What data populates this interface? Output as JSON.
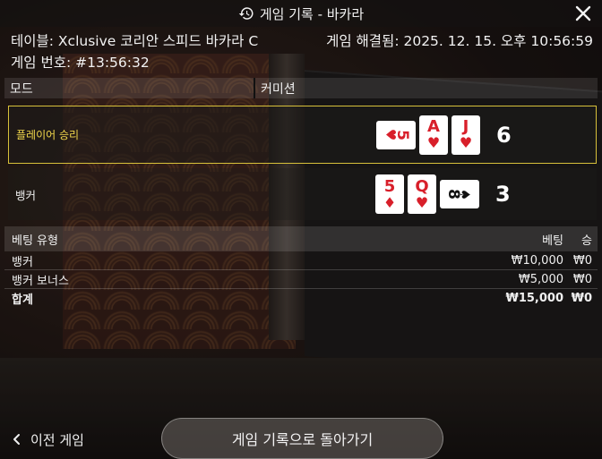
{
  "header": {
    "title": "게임 기록 - 바카라"
  },
  "info": {
    "table": "테이블: Xclusive 코리안 스피드 바카라 C",
    "resolved": "게임 해결됨: 2025. 12. 15. 오후 10:56:59",
    "game_number": "게임 번호: #13:56:32"
  },
  "mode_bar": {
    "mode_label": "모드",
    "commission_label": "커미션"
  },
  "results": {
    "player": {
      "label": "플레이어 승리",
      "score": "6",
      "cards": [
        {
          "rank": "5",
          "suit": "♥",
          "orientation": "sideways",
          "color": "red"
        },
        {
          "rank": "A",
          "suit": "♥",
          "orientation": "upright",
          "color": "red"
        },
        {
          "rank": "J",
          "suit": "♥",
          "orientation": "upright",
          "color": "red"
        }
      ]
    },
    "banker": {
      "label": "뱅커",
      "score": "3",
      "cards": [
        {
          "rank": "5",
          "suit": "♦",
          "orientation": "upright",
          "color": "red"
        },
        {
          "rank": "Q",
          "suit": "♥",
          "orientation": "upright",
          "color": "red"
        },
        {
          "rank": "8",
          "suit": "♠",
          "orientation": "sideways",
          "color": "black"
        }
      ]
    }
  },
  "bets": {
    "headers": {
      "type": "베팅 유형",
      "bet": "베팅",
      "win": "승"
    },
    "rows": [
      {
        "type": "뱅커",
        "bet": "₩10,000",
        "win": "₩0"
      },
      {
        "type": "뱅커 보너스",
        "bet": "₩5,000",
        "win": "₩0"
      }
    ],
    "total": {
      "type": "합계",
      "bet": "₩15,000",
      "win": "₩0"
    }
  },
  "footer": {
    "prev_game": "이전 게임",
    "back_button": "게임 기록으로 돌아가기"
  },
  "colors": {
    "player_highlight": "#d8c13a",
    "card_red": "#d81f2a",
    "card_black": "#111111"
  }
}
